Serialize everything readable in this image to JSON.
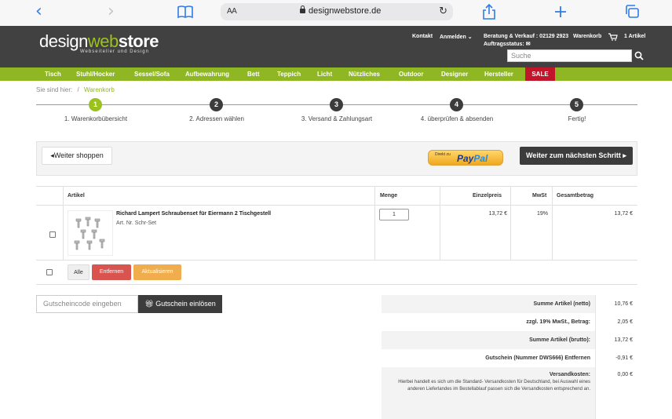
{
  "browser": {
    "aa_label": "AA",
    "url": "designwebstore.de"
  },
  "header": {
    "logo_design": "design",
    "logo_web": "web",
    "logo_store": "store",
    "tagline": "Webseiteller und Design",
    "kontakt": "Kontakt",
    "anmelden": "Anmelden",
    "beratung": "Beratung & Verkauf : 02129 2923",
    "auftragsstatus": "Auftragsstatus:",
    "warenkorb": "Warenkorb",
    "cart_count": "1 Artikel",
    "search_placeholder": "Suche"
  },
  "menu": {
    "items": [
      "Tisch",
      "Stuhl/Hocker",
      "Sessel/Sofa",
      "Aufbewahrung",
      "Bett",
      "Teppich",
      "Licht",
      "Nützliches",
      "Outdoor",
      "Designer",
      "Hersteller"
    ],
    "sale": "SALE"
  },
  "breadcrumb": {
    "prefix": "Sie sind hier:",
    "separator": "/",
    "current": "Warenkorb"
  },
  "steps": [
    {
      "num": "1",
      "label": "1. Warenkorbübersicht"
    },
    {
      "num": "2",
      "label": "2. Adressen wählen"
    },
    {
      "num": "3",
      "label": "3. Versand & Zahlungsart"
    },
    {
      "num": "4",
      "label": "4. überprüfen & absenden"
    },
    {
      "num": "5",
      "label": "Fertig!"
    }
  ],
  "actions": {
    "continue_shopping": "Weiter shoppen",
    "paypal_small": "Direkt zu",
    "paypal_pay": "Pay",
    "paypal_pal": "Pal",
    "next_step": "Weiter zum nächsten Schritt"
  },
  "table": {
    "headers": {
      "artikel": "Artikel",
      "menge": "Menge",
      "einzelpreis": "Einzelpreis",
      "mwst": "MwSt",
      "gesamtbetrag": "Gesamtbetrag"
    },
    "row": {
      "name": "Richard Lampert Schraubenset für Eiermann 2 Tischgestell",
      "art_nr": "Art. Nr. Schr-Set",
      "quantity": "1",
      "unit_price": "13,72 €",
      "vat": "19%",
      "total": "13,72 €"
    },
    "buttons": {
      "all": "Alle",
      "remove": "Entfernen",
      "update": "Aktualisieren"
    }
  },
  "coupon": {
    "placeholder": "Gutscheincode eingeben",
    "button": "Gutschein einlösen"
  },
  "totals": [
    {
      "label": "Summe Artikel (netto)",
      "value": "10,76 €"
    },
    {
      "label": "zzgl. 19% MwSt., Betrag:",
      "value": "2,05 €"
    },
    {
      "label": "Summe Artikel (brutto):",
      "value": "13,72 €"
    },
    {
      "label": "Gutschein (Nummer DWS666) Entfernen",
      "value": "-0,91 €"
    },
    {
      "label": "Versandkosten:",
      "value": "0,00 €"
    }
  ],
  "shipping_note": "Hierbei handelt es sich um die Standard- Versandkosten für Deutschland, bei Auswahl eines anderen Lieferlandes im Bestellablauf passen sich die Versandkosten entsprechend an.",
  "colors": {
    "green": "#8fb623",
    "dark": "#414141",
    "sale": "#c0152a",
    "remove": "#d9534f",
    "update": "#f0ad4e",
    "ios_blue": "#2f7bea"
  }
}
